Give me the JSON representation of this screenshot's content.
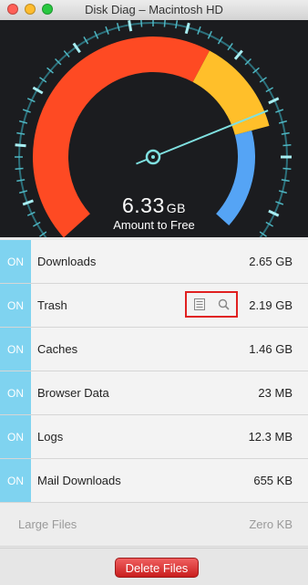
{
  "window": {
    "title": "Disk Diag – Macintosh HD"
  },
  "gauge": {
    "amount_value": "6.33",
    "amount_unit": "GB",
    "amount_label": "Amount to Free",
    "segment_colors": {
      "red": "#fe4a23",
      "yellow": "#ffbf2a",
      "blue": "#55a4f5",
      "needle": "#7fe0e0"
    }
  },
  "items": [
    {
      "toggle": "ON",
      "label": "Downloads",
      "size": "2.65 GB"
    },
    {
      "toggle": "ON",
      "label": "Trash",
      "size": "2.19 GB"
    },
    {
      "toggle": "ON",
      "label": "Caches",
      "size": "1.46 GB"
    },
    {
      "toggle": "ON",
      "label": "Browser Data",
      "size": "23 MB"
    },
    {
      "toggle": "ON",
      "label": "Logs",
      "size": "12.3 MB"
    },
    {
      "toggle": "ON",
      "label": "Mail Downloads",
      "size": "655 KB"
    }
  ],
  "large_files": {
    "label": "Large Files",
    "size": "Zero KB"
  },
  "trash_actions": {
    "icons": [
      "list-icon",
      "magnifier-icon"
    ]
  },
  "footer": {
    "delete_label": "Delete Files"
  },
  "colors": {
    "toggle_on": "#7fd3f0",
    "delete_button": "#d42626"
  }
}
